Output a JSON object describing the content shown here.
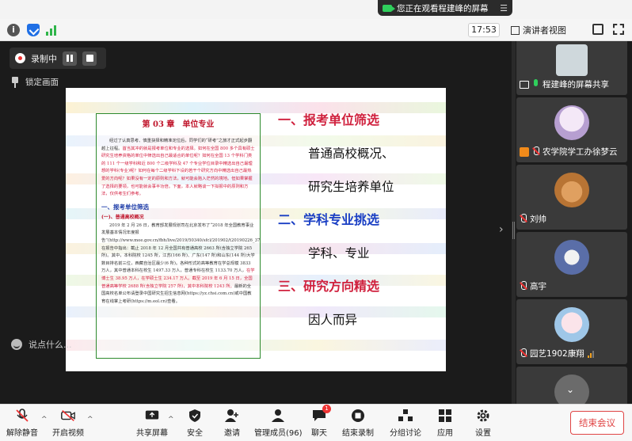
{
  "banner": {
    "text": "您正在观看程建峰的屏幕",
    "menu_icon": "hamburger-icon"
  },
  "toolbar": {
    "time": "17:53",
    "view_label": "演讲者视图"
  },
  "recording": {
    "label": "录制中"
  },
  "lock_view": {
    "label": "锁定画面"
  },
  "chat": {
    "placeholder": "说点什么..."
  },
  "slide": {
    "doc_title": "第 03 章　单位专业",
    "doc_para1_a": "经过了认真思考、慎重抉择和精准定位后，同学们的“研考”之旅才正式起步翻越上征程。",
    "doc_para1_b": "首当其冲的就是报考单位和专业的选择。如何在全国 800 多个具有硕士研究生培养资格的单位中筛选出自己最适合的单位呢？如何在全国 13 个学科门类的 111 个一级学科和近 800 个二级学科及 47 个专业学位目录中精选出自己最理想的学科(专业)呢？如何在每个二级学科下设的若干个研究方向中精选出自己最热爱的方向呢？",
    "doc_para1_c": "如果没有一定的原则和方法，就可能会陷入茫然的境地。但如果掌握了选择的要领，也可能就会事半功倍。下面，本人就略谈一下拟报中的原则和方法，仅供考生们参考。",
    "doc_sec1": "一、报考单位筛选",
    "doc_sub1": "(一)、普通高校概况",
    "doc_para2_a": "2019 年 2 月 26 日，教育部发展规划司在北京发布了“2018 年全国教育事业发展基本情况年度报告”(http://www.moe.gov.cn/fbh/live/2019/50340/sfcl/201902/t20190226_371173.html)，在报告中指出：截止 2018 年 12 月全国共有普通高校 2663 所(含独立学院 265 所)。其中，本科院校 1245 所，江苏(166 所)、广东(147 所)和山东(144 所)大学数目排名前三位，西藏自治区最少(6 所)。各种形式的高等教育在学总规模 3833 万人，其中普通本科在校生 1497.33 万人，普通专科在校生 1133.70 万人，",
    "doc_para2_b": "在学博士生 38.95 万人，在学硕士生 234.17 万人。截至 2019 年 6 月 15 日，全国普通高等学校 2688 所(含独立学院 257 所)，其中本科院校 1243 所。",
    "doc_para2_c": "最新的全国高校名单公布请登录中国研究生招生信息网(https://yz.chsi.com.cn)或中国教育在线掌上考研(https://m.eol.cn)查看。",
    "outline": [
      {
        "text": "一、报考单位筛选",
        "color": "#d0213e"
      },
      {
        "text": "普通高校概况、"
      },
      {
        "text": "研究生培养单位"
      },
      {
        "text": "二、学科专业挑选",
        "color": "#1a3fc4"
      },
      {
        "text": "学科、专业"
      },
      {
        "text": "三、研究方向精选",
        "color": "#d0213e"
      },
      {
        "text": "因人而异"
      }
    ]
  },
  "participants": [
    {
      "name": "程建峰的屏幕共享",
      "avatar": "screen-thumbnail"
    },
    {
      "name": "农学院学工办徐梦云",
      "avatar": "anime-girl-avatar"
    },
    {
      "name": "刘帅",
      "avatar": "bear-avatar"
    },
    {
      "name": "高宇",
      "avatar": "cartoon-shark-avatar"
    },
    {
      "name": "园艺1902康翔",
      "avatar": "anime-character-avatar"
    }
  ],
  "bottombar": {
    "unmute": "解除静音",
    "start_video": "开启视频",
    "share_screen": "共享屏幕",
    "security": "安全",
    "invite": "邀请",
    "manage_members": "管理成员(96)",
    "chat": "聊天",
    "chat_badge": "1",
    "stop_recording": "结束录制",
    "breakout": "分组讨论",
    "apps": "应用",
    "settings": "设置",
    "end_meeting": "结束会议"
  }
}
